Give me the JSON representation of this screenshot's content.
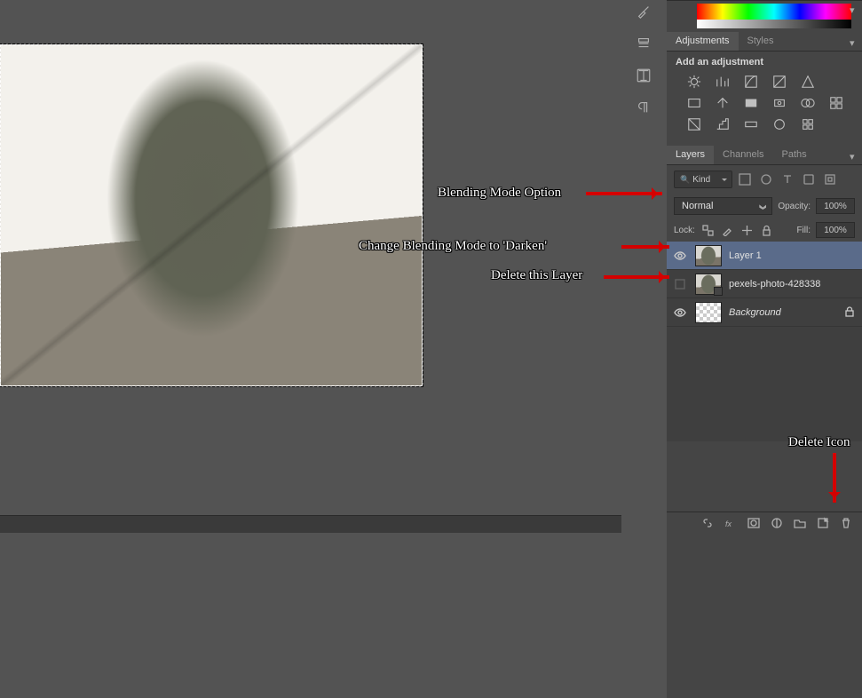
{
  "panels": {
    "adjustments_tab": "Adjustments",
    "styles_tab": "Styles",
    "add_adjustment": "Add an adjustment",
    "layers_tab": "Layers",
    "channels_tab": "Channels",
    "paths_tab": "Paths"
  },
  "layers_panel": {
    "filter_kind": "Kind",
    "blend_mode": "Normal",
    "opacity_label": "Opacity:",
    "opacity_value": "100%",
    "lock_label": "Lock:",
    "fill_label": "Fill:",
    "fill_value": "100%",
    "layers": [
      {
        "name": "Layer 1",
        "visible": true,
        "selected": true,
        "italic": false
      },
      {
        "name": "pexels-photo-428338",
        "visible": false,
        "selected": false,
        "italic": false
      },
      {
        "name": "Background",
        "visible": true,
        "selected": false,
        "italic": true,
        "locked": true
      }
    ]
  },
  "annotations": {
    "blend_label": "Blending Mode Option",
    "darken_label": "Change Blending Mode to 'Darken'",
    "delete_layer_label": "Delete this Layer",
    "delete_icon_label": "Delete Icon"
  }
}
